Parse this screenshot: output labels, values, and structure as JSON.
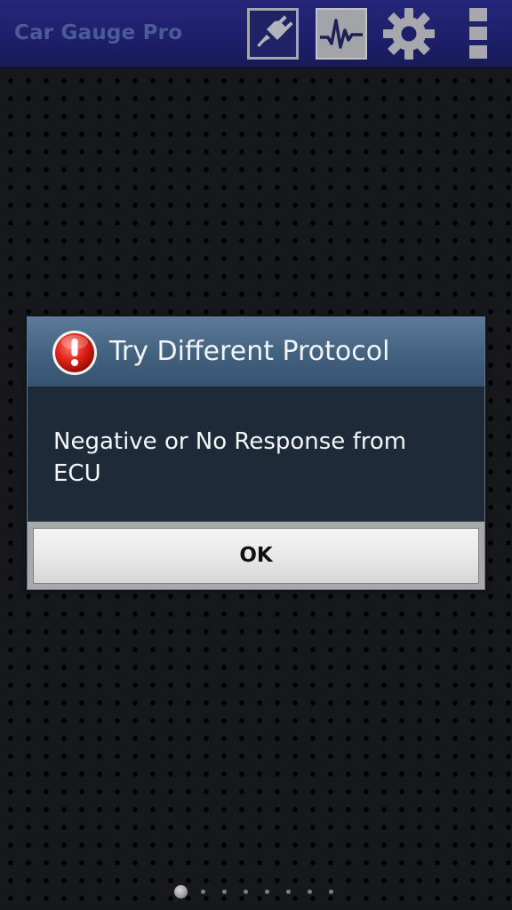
{
  "action_bar": {
    "title": "Car Gauge Pro",
    "icons": [
      "plug-icon",
      "graph-icon",
      "gear-icon",
      "overflow-menu-icon"
    ],
    "background_color": "#1d1f6a",
    "title_color": "#4c5a95"
  },
  "dialog": {
    "title": "Try Different Protocol",
    "icon": "alert-icon",
    "message": "Negative or No Response from ECU",
    "ok_label": "OK",
    "header_color": "#42617f",
    "body_color": "#1e2a38"
  },
  "pager": {
    "page_count": 8,
    "active_index": 0
  }
}
